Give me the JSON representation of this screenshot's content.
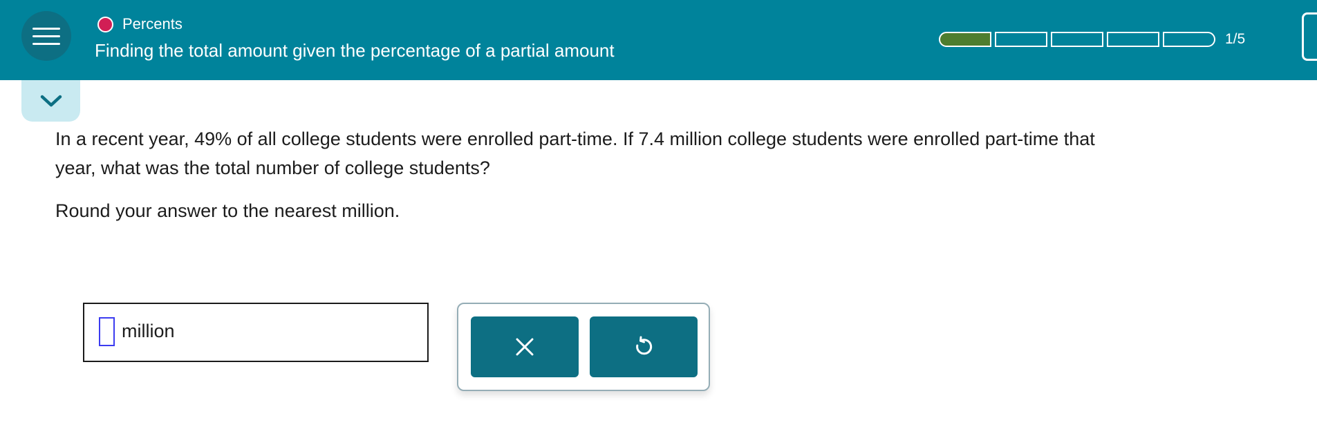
{
  "header": {
    "topic": "Percents",
    "title": "Finding the total amount given the percentage of a partial amount",
    "progress": {
      "completed": 1,
      "total": 5,
      "label": "1/5"
    }
  },
  "question": {
    "text": "In a recent year, 49% of all college students were enrolled part-time. If 7.4 million college students were enrolled part-time that\nyear, what was the total number of college students?",
    "instruction": "Round your answer to the nearest million."
  },
  "answer": {
    "value": "",
    "unit": "million"
  },
  "colors": {
    "header_bg": "#00839b",
    "menu_circle": "#0d6f83",
    "topic_dot": "#d11f55",
    "progress_fill": "#4e7d2f",
    "collapse_tab": "#c9eaf1",
    "action_button": "#0d6f83",
    "input_cursor": "#3b3bf0"
  },
  "icons": {
    "menu": "hamburger-icon",
    "collapse": "chevron-down-icon",
    "clear": "x-icon",
    "undo": "undo-icon"
  }
}
